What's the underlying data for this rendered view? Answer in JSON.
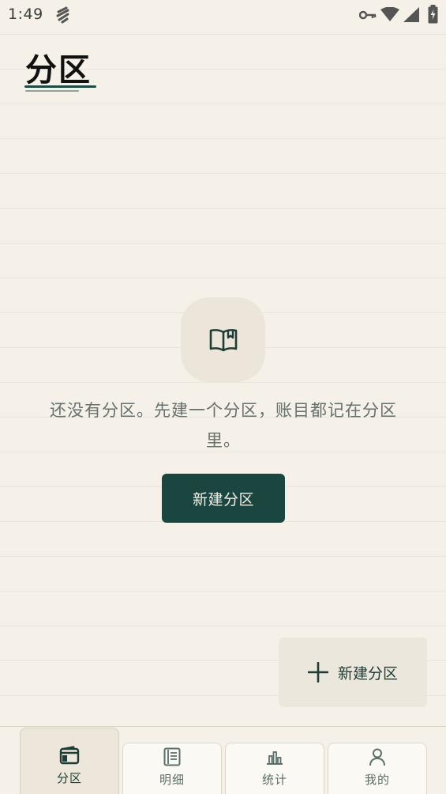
{
  "status_bar": {
    "time": "1:49",
    "icons": [
      "sync-icon",
      "vpn-key-icon",
      "wifi-icon",
      "signal-icon",
      "battery-charging-icon"
    ]
  },
  "page": {
    "title": "分区"
  },
  "empty_state": {
    "icon": "open-book-icon",
    "message": "还没有分区。先建一个分区，账目都记在分区里。",
    "button_label": "新建分区"
  },
  "fab": {
    "icon": "plus-icon",
    "label": "新建分区"
  },
  "bottom_nav": {
    "items": [
      {
        "label": "分区",
        "icon": "wallet-icon",
        "active": true
      },
      {
        "label": "明细",
        "icon": "list-doc-icon",
        "active": false
      },
      {
        "label": "统计",
        "icon": "bar-chart-icon",
        "active": false
      },
      {
        "label": "我的",
        "icon": "person-icon",
        "active": false
      }
    ]
  },
  "colors": {
    "background": "#f5f1e8",
    "accent": "#1b4640",
    "text_muted": "#66706c"
  }
}
